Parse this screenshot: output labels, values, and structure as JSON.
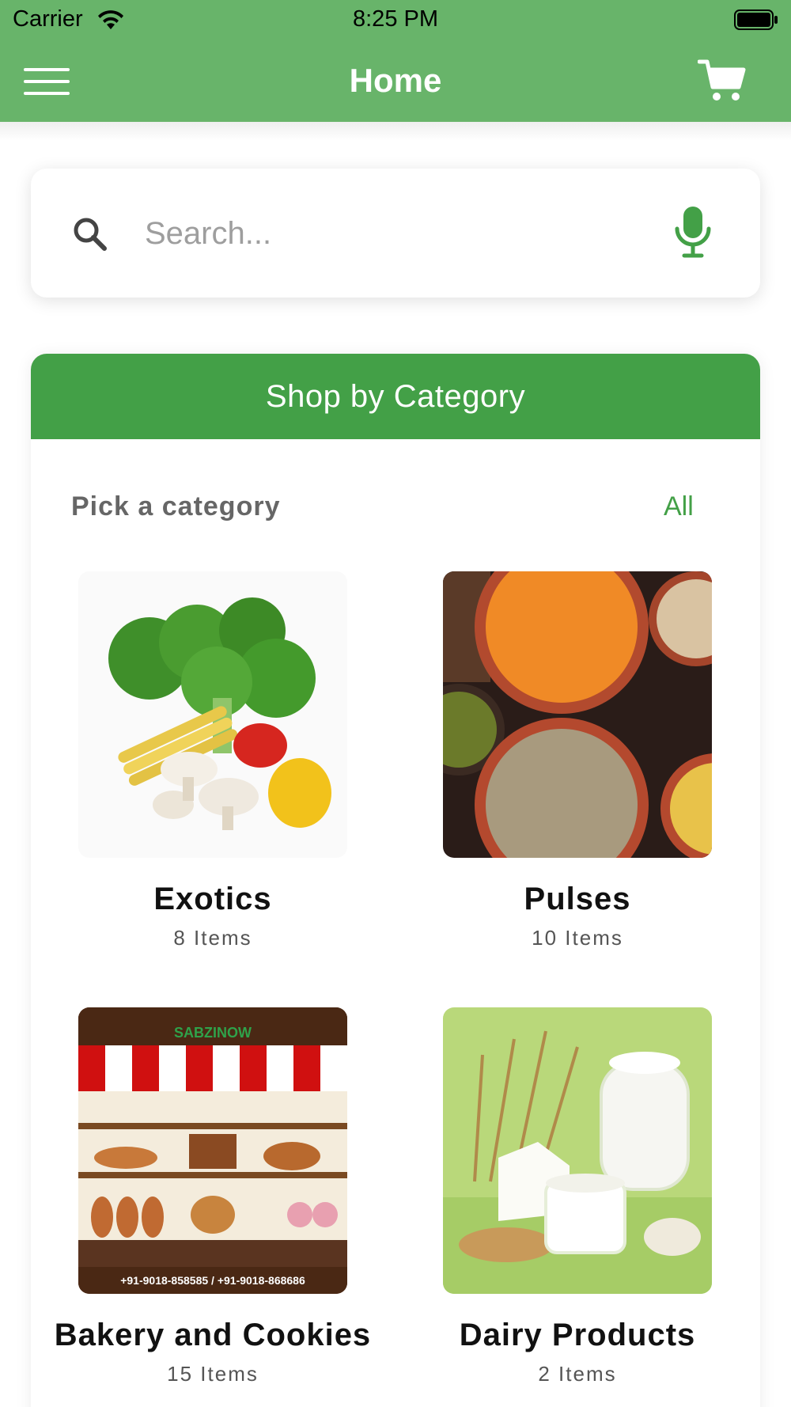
{
  "status_bar": {
    "carrier": "Carrier",
    "time": "8:25 PM"
  },
  "nav": {
    "title": "Home",
    "menu_icon": "hamburger-menu-icon",
    "cart_icon": "cart-icon"
  },
  "search": {
    "placeholder": "Search...",
    "value": "",
    "search_icon": "search-icon",
    "mic_icon": "microphone-icon"
  },
  "category_panel": {
    "title": "Shop by Category",
    "subtitle": "Pick a category",
    "all_link": "All",
    "categories": [
      {
        "name": "Exotics",
        "count": "8 Items"
      },
      {
        "name": "Pulses",
        "count": "10 Items"
      },
      {
        "name": "Bakery and Cookies",
        "count": "15 Items",
        "image_text": "SABZINOW",
        "image_phone": "+91-9018-858585  /  +91-9018-868686"
      },
      {
        "name": "Dairy Products",
        "count": "2 Items"
      }
    ]
  },
  "colors": {
    "nav_bg": "#68b46a",
    "accent": "#43a047",
    "mic": "#43a047"
  }
}
